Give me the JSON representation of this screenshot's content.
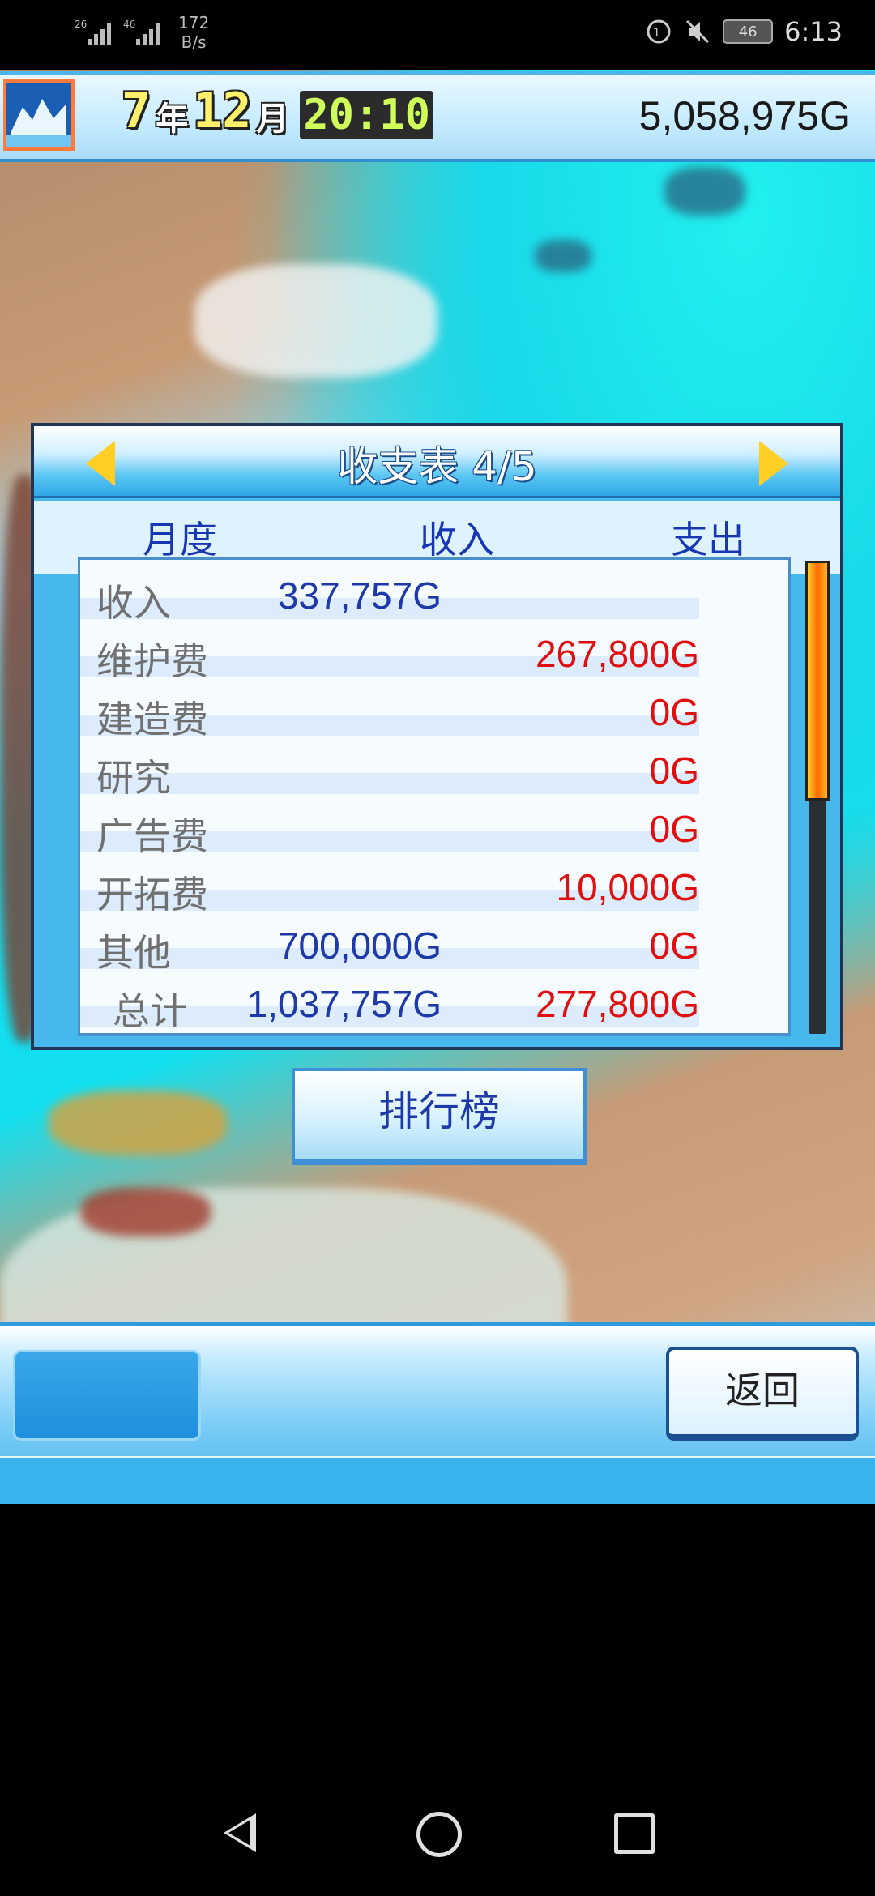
{
  "status_bar": {
    "signal1": "26",
    "signal2": "46",
    "speed": "172",
    "speed_unit": "B/s",
    "battery": "46",
    "time": "6:13"
  },
  "header": {
    "year": "7",
    "year_unit": "年",
    "month": "12",
    "month_unit": "月",
    "clock": "20:10",
    "money": "5,058,975G"
  },
  "dialog": {
    "title": "收支表 4/5",
    "columns": {
      "month": "月度",
      "income": "收入",
      "expense": "支出"
    },
    "rows": [
      {
        "label": "收入",
        "income": "337,757G",
        "expense": ""
      },
      {
        "label": "维护费",
        "income": "",
        "expense": "267,800G"
      },
      {
        "label": "建造费",
        "income": "",
        "expense": "0G"
      },
      {
        "label": "研究",
        "income": "",
        "expense": "0G"
      },
      {
        "label": "广告费",
        "income": "",
        "expense": "0G"
      },
      {
        "label": "开拓费",
        "income": "",
        "expense": "10,000G"
      },
      {
        "label": "其他",
        "income": "700,000G",
        "expense": "0G"
      },
      {
        "label": "总计",
        "income": "1,037,757G",
        "expense": "277,800G"
      }
    ],
    "scroll_position": 0.5
  },
  "ranking_button": "排行榜",
  "bottom": {
    "back_button": "返回"
  },
  "colors": {
    "income_text": "#1d3aa8",
    "expense_text": "#e01010",
    "accent": "#46b8ec"
  }
}
